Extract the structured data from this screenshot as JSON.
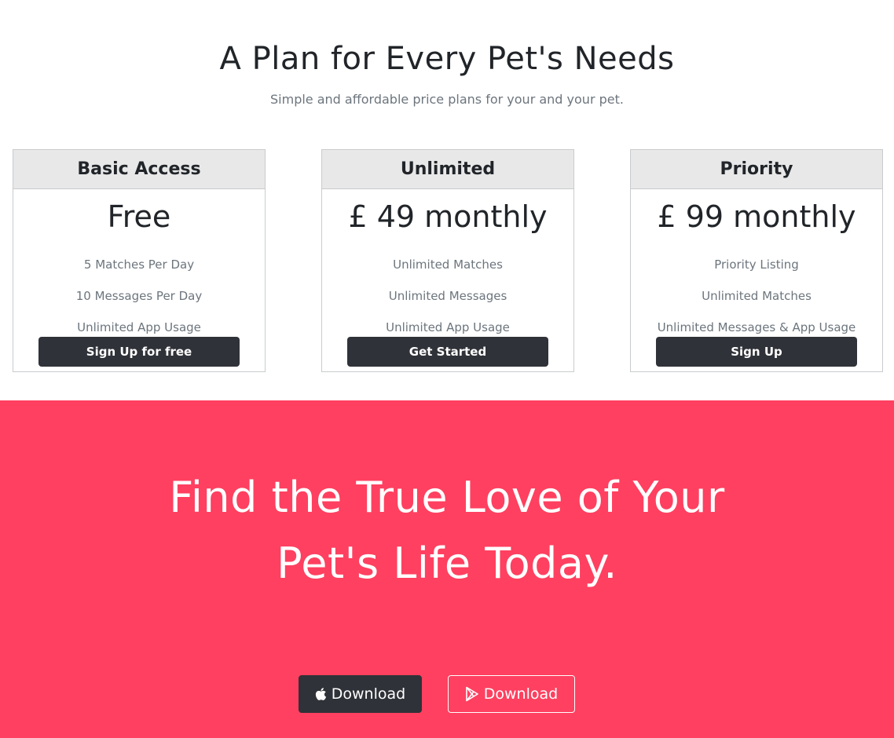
{
  "pricing": {
    "title": "A Plan for Every Pet's Needs",
    "subtitle": "Simple and affordable price plans for your and your pet.",
    "plans": [
      {
        "name": "Basic Access",
        "price": "Free",
        "features": [
          "5 Matches Per Day",
          "10 Messages Per Day",
          "Unlimited App Usage"
        ],
        "button_label": "Sign Up for free"
      },
      {
        "name": "Unlimited",
        "price": "£ 49 monthly",
        "features": [
          "Unlimited Matches",
          "Unlimited Messages",
          "Unlimited App Usage"
        ],
        "button_label": "Get Started"
      },
      {
        "name": "Priority",
        "price": "£ 99 monthly",
        "features": [
          "Priority Listing",
          "Unlimited Matches",
          "Unlimited Messages & App Usage"
        ],
        "button_label": "Sign Up"
      }
    ]
  },
  "cta": {
    "heading_line1": "Find the True Love of Your",
    "heading_line2": "Pet's Life Today.",
    "apple_download_label": "Download",
    "apple_icon": "apple-icon",
    "play_download_label": "Download",
    "play_icon": "google-play-icon"
  },
  "colors": {
    "accent": "#ff4060",
    "dark_button": "#2f3238",
    "card_header_bg": "#e8e8e8",
    "muted_text": "#6c757d"
  }
}
